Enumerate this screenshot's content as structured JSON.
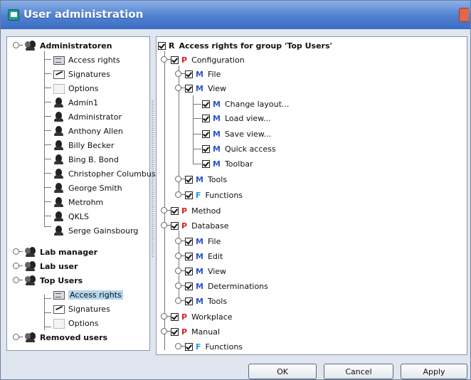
{
  "window": {
    "title": "User administration"
  },
  "left_tree": {
    "group1": "Administratoren",
    "g1_access": "Access rights",
    "g1_sign": "Signatures",
    "g1_options": "Options",
    "users": [
      "Admin1",
      "Administrator",
      "Anthony Allen",
      "Billy Becker",
      "Bing B. Bond",
      "Christopher Columbus",
      "George Smith",
      "Metrohm",
      "QKLS",
      "Serge Gainsbourg"
    ],
    "group2": "Lab manager",
    "group3": "Lab user",
    "group4": "Top Users",
    "g4_access": "Access rights",
    "g4_sign": "Signatures",
    "g4_options": "Options",
    "group5": "Removed users"
  },
  "right_tree": {
    "root_tag": "R",
    "root_label": "Access rights for group 'Top Users'",
    "configuration": "Configuration",
    "config_file": "File",
    "config_view": "View",
    "change_layout": "Change layout...",
    "load_view": "Load view...",
    "save_view": "Save view...",
    "quick_access": "Quick access",
    "toolbar": "Toolbar",
    "config_tools": "Tools",
    "config_functions": "Functions",
    "method": "Method",
    "database": "Database",
    "db_file": "File",
    "db_edit": "Edit",
    "db_view": "View",
    "db_determinations": "Determinations",
    "db_tools": "Tools",
    "workplace": "Workplace",
    "manual": "Manual",
    "manual_functions": "Functions",
    "tag_p": "P",
    "tag_m": "M",
    "tag_f": "F"
  },
  "buttons": {
    "ok": "OK",
    "cancel": "Cancel",
    "apply": "Apply"
  },
  "colors": {
    "tag_p": "#d22222",
    "tag_m": "#2e54c8",
    "tag_f": "#1a9bd8",
    "title_bar": "#4f80cf",
    "selection": "#b4d5ee"
  }
}
